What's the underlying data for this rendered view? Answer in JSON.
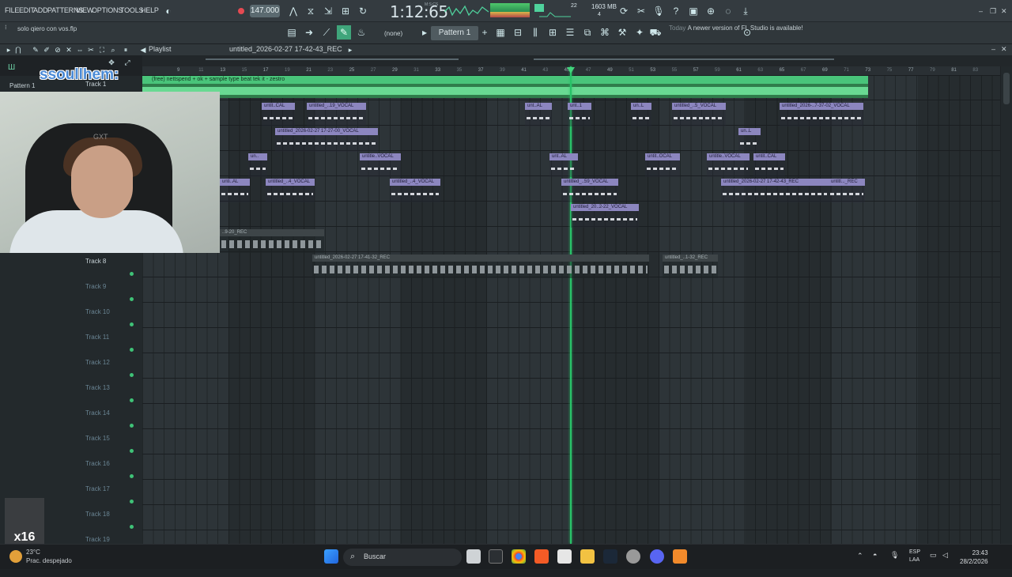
{
  "menubar": {
    "items": [
      "FILE",
      "EDIT",
      "ADD",
      "PATTERNS",
      "VIEW",
      "OPTIONS",
      "TOOLS",
      "HELP"
    ],
    "tempo": "147.000",
    "time": "1:12:65",
    "time_label": "M:S:CS",
    "mem": "1603 MB",
    "cpu_val": "22",
    "poly_val": "4",
    "colors": {
      "accent": "#55c9a7",
      "record": "#e54a52",
      "playhead": "#28c268"
    }
  },
  "toolbar2": {
    "hint_text": "solo qiero con vos.flp",
    "none_label": "(none)",
    "pattern_label": "Pattern 1",
    "news_when": "Today",
    "news_text": "A newer version of FL Studio is available!"
  },
  "playlist": {
    "title": "untitled_2026-02-27 17-42-43_REC",
    "tab": "Playlist",
    "pattern_label": "Pattern 1",
    "beat_clip_label": "(free) nettspend + ok + sample type beat tek it - zestro",
    "ruler": [
      "9",
      "11",
      "13",
      "15",
      "17",
      "19",
      "21",
      "23",
      "25",
      "27",
      "29",
      "31",
      "33",
      "35",
      "37",
      "39",
      "41",
      "43",
      "45",
      "47",
      "49",
      "51",
      "53",
      "55",
      "57",
      "59",
      "61",
      "63",
      "65",
      "67",
      "69",
      "71",
      "73",
      "75",
      "77",
      "79",
      "81",
      "83"
    ],
    "tracks": [
      {
        "name": "Track 1",
        "top": 0
      },
      {
        "name": "Track 8"
      },
      {
        "name": "Track 9"
      },
      {
        "name": "Track 10"
      },
      {
        "name": "Track 11"
      },
      {
        "name": "Track 12"
      },
      {
        "name": "Track 13"
      },
      {
        "name": "Track 14"
      },
      {
        "name": "Track 15"
      },
      {
        "name": "Track 16"
      },
      {
        "name": "Track 17"
      },
      {
        "name": "Track 18"
      },
      {
        "name": "Track 19"
      }
    ],
    "clips": [
      {
        "label": "untit..CAL"
      },
      {
        "label": "untitled_..19_VOCAL"
      },
      {
        "label": "unt..AL"
      },
      {
        "label": "unt..1"
      },
      {
        "label": "un..L"
      },
      {
        "label": "untitled_..5_VOCAL"
      },
      {
        "label": "untitled_2026-..7-37-02_VOCAL"
      },
      {
        "label": "untitled_2026-02-27 17-27-00_VOCAL"
      },
      {
        "label": "un..L"
      },
      {
        "label": "un.."
      },
      {
        "label": "untitle..VOCAL"
      },
      {
        "label": "unt..AL"
      },
      {
        "label": "untit..OCAL"
      },
      {
        "label": "untitle..VOCAL"
      },
      {
        "label": "untit..CAL"
      },
      {
        "label": "unti..AL"
      },
      {
        "label": "untitled_..4_VOCAL"
      },
      {
        "label": "untitled_..4_VOCAL"
      },
      {
        "label": "untitled_..59_VOCAL"
      },
      {
        "label": "untitled_2026-02-27 17-42-43_REC"
      },
      {
        "label": "untitl..._REC"
      },
      {
        "label": "untitled_20..2-22_VOCAL"
      },
      {
        "label": "..9-20_REC"
      },
      {
        "label": "untitled_2026-02-27 17-41-32_REC"
      },
      {
        "label": "untitled_..1-32_REC"
      }
    ]
  },
  "overlay": {
    "streamer": "ssoullhem:",
    "watermark": "x16",
    "webcam_tag": "GXT"
  },
  "taskbar": {
    "search": "Buscar",
    "weather_temp": "23°C",
    "weather_desc": "Prac. despejado",
    "lang1": "ESP",
    "lang2": "LAA",
    "time": "23:43",
    "date": "28/2/2026"
  }
}
